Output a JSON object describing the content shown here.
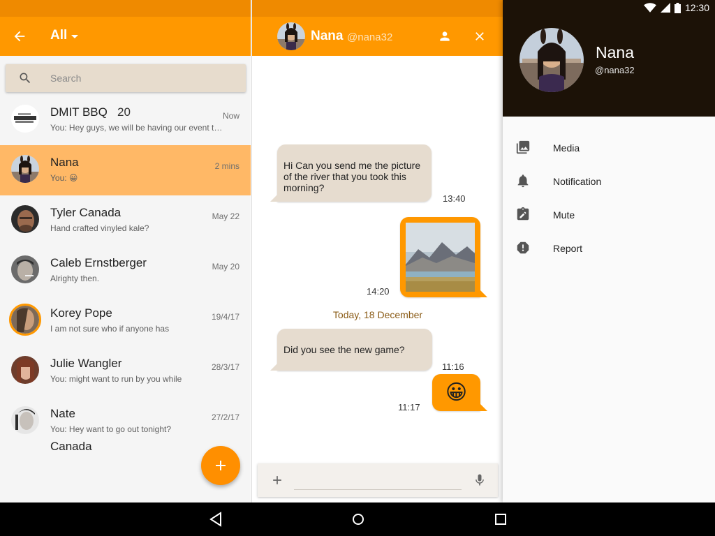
{
  "status_bar": {
    "time": "12:30"
  },
  "list_pane": {
    "filter_label": "All",
    "search_placeholder": "Search",
    "conversations": [
      {
        "name": "DMIT BBQ",
        "count": "20",
        "preview": "You: Hey guys, we will be having our event to...",
        "time": "Now"
      },
      {
        "name": "Nana",
        "preview": "You: 😀",
        "time": "2 mins"
      },
      {
        "name": "Tyler Canada",
        "preview": "Hand crafted vinyled kale?",
        "time": "May 22"
      },
      {
        "name": "Caleb Ernstberger",
        "preview": "Alrighty then.",
        "time": "May 20"
      },
      {
        "name": "Korey Pope",
        "preview": "I am not sure who if anyone has",
        "time": "19/4/17"
      },
      {
        "name": "Julie Wangler",
        "preview": "You: might want to run by you while",
        "time": "28/3/17"
      },
      {
        "name": "Nate",
        "preview": "You: Hey want to go out tonight?",
        "time": "27/2/17",
        "extra": "Canada"
      }
    ]
  },
  "chat_pane": {
    "contact_name": "Nana",
    "contact_handle": "@nana32",
    "messages": [
      {
        "text": "Hi Can you send me the picture of the river that you took this morning?",
        "time": "13:40"
      },
      {
        "time": "14:20"
      },
      {
        "day_separator": "Today, 18 December"
      },
      {
        "text": "Did you see the new game?",
        "time": "11:16"
      },
      {
        "text": "😀",
        "time": "11:17"
      }
    ],
    "composer_placeholder": ""
  },
  "profile_pane": {
    "name": "Nana",
    "handle": "@nana32",
    "menu": [
      {
        "label": "Media",
        "icon": "photo-library-icon"
      },
      {
        "label": "Notification",
        "icon": "bell-icon"
      },
      {
        "label": "Mute",
        "icon": "assignment-edit-icon"
      },
      {
        "label": "Report",
        "icon": "report-icon"
      }
    ]
  },
  "colors": {
    "primary": "#ff9800",
    "primary_dark": "#ef8a00",
    "active_row": "#ffb866",
    "incoming_bubble": "#e6dccf",
    "profile_header": "#1c1207"
  }
}
